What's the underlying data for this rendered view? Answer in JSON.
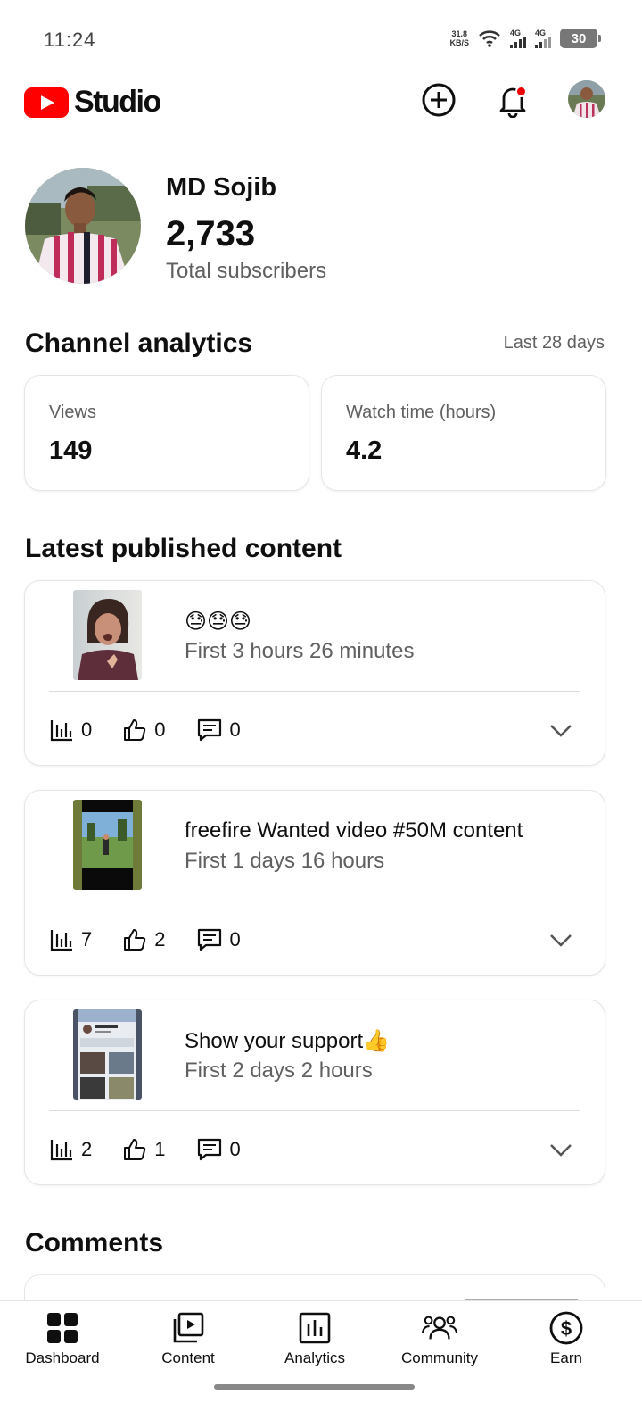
{
  "status_bar": {
    "time": "11:24",
    "net_speed_value": "31.8",
    "net_speed_unit": "KB/S",
    "signal_1": "4G",
    "signal_2": "4G",
    "battery": "30"
  },
  "header": {
    "logo_text": "Studio",
    "icons": [
      "create-icon",
      "notifications-icon",
      "account-avatar"
    ]
  },
  "channel": {
    "name": "MD Sojib",
    "subscriber_count": "2,733",
    "subscriber_label": "Total subscribers"
  },
  "analytics": {
    "title": "Channel analytics",
    "range": "Last 28 days",
    "metrics": [
      {
        "label": "Views",
        "value": "149"
      },
      {
        "label": "Watch time (hours)",
        "value": "4.2"
      }
    ]
  },
  "latest": {
    "title": "Latest published content",
    "videos": [
      {
        "title": "😓😓😓",
        "subtitle": "First 3 hours 26 minutes",
        "views": "0",
        "likes": "0",
        "comments": "0"
      },
      {
        "title": "freefire Wanted video  #50M content",
        "subtitle": "First 1 days 16 hours",
        "views": "7",
        "likes": "2",
        "comments": "0"
      },
      {
        "title": "Show your support👍",
        "subtitle": "First 2 days 2 hours",
        "views": "2",
        "likes": "1",
        "comments": "0"
      }
    ]
  },
  "comments": {
    "title": "Comments"
  },
  "bottom_nav": [
    {
      "label": "Dashboard",
      "icon": "dashboard-icon"
    },
    {
      "label": "Content",
      "icon": "content-icon"
    },
    {
      "label": "Analytics",
      "icon": "analytics-icon"
    },
    {
      "label": "Community",
      "icon": "community-icon"
    },
    {
      "label": "Earn",
      "icon": "earn-icon"
    }
  ],
  "colors": {
    "brand_red": "#ff0000",
    "notification_dot": "#ee0000",
    "text_primary": "#0f0f0f",
    "text_secondary": "#606060"
  }
}
